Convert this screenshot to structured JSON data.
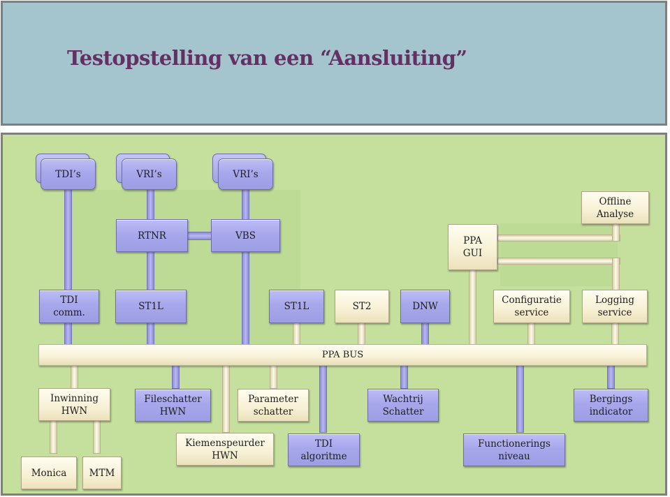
{
  "title": "Testopstelling van een “Aansluiting”",
  "bus_label": "PPA BUS",
  "colors": {
    "title_text": "#643064",
    "title_panel": "#a4c4ce",
    "diagram_panel": "#c4e09c",
    "blue_box": "#a7a7ec",
    "cream_box": "#f7f0d4",
    "border": "#7f7f7f"
  },
  "nodes": {
    "tdis": "TDI’s",
    "vris_1": "VRI’s",
    "vris_2": "VRI’s",
    "rtnr": "RTNR",
    "vbs": "VBS",
    "offline_analyse": "Offline\nAnalyse",
    "ppa_gui": "PPA\nGUI",
    "tdi_comm": "TDI\ncomm.",
    "st1l_1": "ST1L",
    "st1l_2": "ST1L",
    "st2": "ST2",
    "dnw": "DNW",
    "configuratie_service": "Configuratie\nservice",
    "logging_service": "Logging\nservice",
    "inwinning_hwn": "Inwinning\nHWN",
    "fileschatter_hwn": "Fileschatter\nHWN",
    "parameter_schatter": "Parameter\nschatter",
    "wachtrij_schatter": "Wachtrij\nSchatter",
    "bergings_indicator": "Bergings\nindicator",
    "kiemenspeurder_hwn": "Kiemenspeurder\nHWN",
    "tdi_algoritme": "TDI\nalgoritme",
    "functionerings_niveau": "Functionerings\nniveau",
    "monica": "Monica",
    "mtm": "MTM"
  }
}
